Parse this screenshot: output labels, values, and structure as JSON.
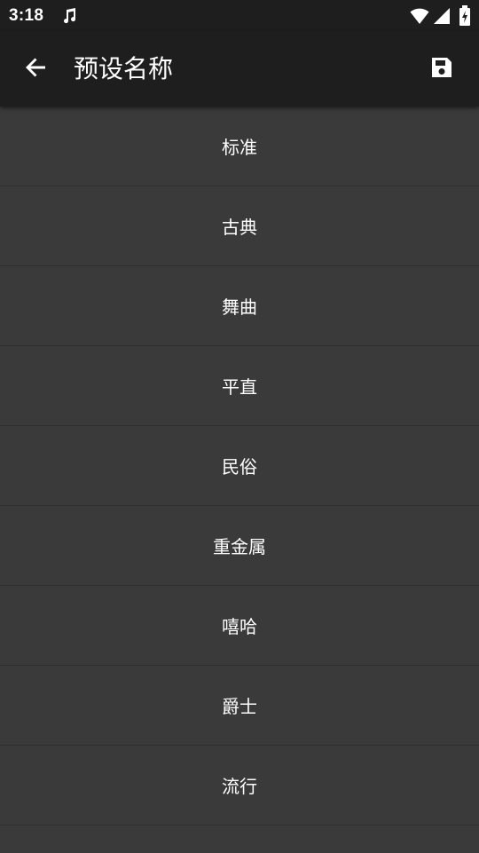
{
  "status_bar": {
    "time": "3:18"
  },
  "app_bar": {
    "title": "预设名称"
  },
  "presets": [
    {
      "label": "标准"
    },
    {
      "label": "古典"
    },
    {
      "label": "舞曲"
    },
    {
      "label": "平直"
    },
    {
      "label": "民俗"
    },
    {
      "label": "重金属"
    },
    {
      "label": "嘻哈"
    },
    {
      "label": "爵士"
    },
    {
      "label": "流行"
    }
  ],
  "icons": {
    "status": [
      "music-icon",
      "wifi-icon",
      "cell-signal-icon",
      "battery-icon"
    ],
    "app_bar": [
      "back-arrow-icon",
      "save-icon"
    ]
  },
  "colors": {
    "status_bar_bg": "#1e1e1e",
    "app_bar_bg": "#1e1e1e",
    "list_bg": "#3a3a3a",
    "divider": "#2f2f2f",
    "text": "#ffffff"
  }
}
